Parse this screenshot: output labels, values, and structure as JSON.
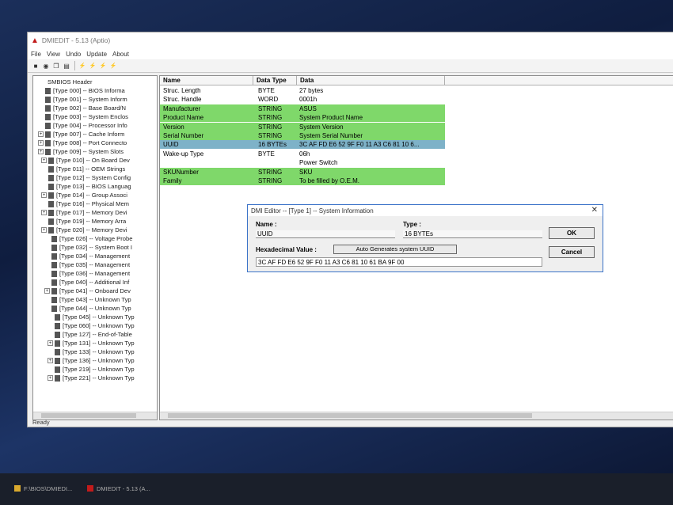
{
  "window": {
    "title": "DMIEDIT - 5.13 (Aptio)"
  },
  "menu": [
    "File",
    "View",
    "Undo",
    "Update",
    "About"
  ],
  "toolbar": {
    "buttons": [
      "save-icon",
      "open-icon",
      "copy-icon",
      "doc-icon",
      "all-icon-1",
      "all-icon-2",
      "all-icon-3",
      "all-icon-4"
    ]
  },
  "tree": {
    "items": [
      {
        "label": "SMBIOS Header",
        "exp": ""
      },
      {
        "label": "[Type 000] -- BIOS Informa",
        "exp": ""
      },
      {
        "label": "[Type 001] -- System Inform",
        "exp": ""
      },
      {
        "label": "[Type 002] -- Base Board/N",
        "exp": ""
      },
      {
        "label": "[Type 003] -- System Enclos",
        "exp": ""
      },
      {
        "label": "[Type 004] -- Processor Info",
        "exp": ""
      },
      {
        "label": "[Type 007] -- Cache Inform",
        "exp": "+"
      },
      {
        "label": "[Type 008] -- Port Connecto",
        "exp": "+"
      },
      {
        "label": "[Type 009] -- System Slots",
        "exp": "+"
      },
      {
        "label": "[Type 010] -- On Board Dev",
        "exp": "+"
      },
      {
        "label": "[Type 011] -- OEM Strings",
        "exp": ""
      },
      {
        "label": "[Type 012] -- System Config",
        "exp": ""
      },
      {
        "label": "[Type 013] -- BIOS Languag",
        "exp": ""
      },
      {
        "label": "[Type 014] -- Group Associ",
        "exp": "+"
      },
      {
        "label": "[Type 016] -- Physical Mem",
        "exp": ""
      },
      {
        "label": "[Type 017] -- Memory Devi",
        "exp": "+"
      },
      {
        "label": "[Type 019] -- Memory Arra",
        "exp": ""
      },
      {
        "label": "[Type 020] -- Memory Devi",
        "exp": "+"
      },
      {
        "label": "[Type 026] -- Voltage Probe",
        "exp": ""
      },
      {
        "label": "[Type 032] -- System Boot I",
        "exp": ""
      },
      {
        "label": "[Type 034] -- Management",
        "exp": ""
      },
      {
        "label": "[Type 035] -- Management",
        "exp": ""
      },
      {
        "label": "[Type 036] -- Management",
        "exp": ""
      },
      {
        "label": "[Type 040] -- Additional Inf",
        "exp": ""
      },
      {
        "label": "[Type 041] -- Onboard Dev",
        "exp": "+"
      },
      {
        "label": "[Type 043] -- Unknown Typ",
        "exp": ""
      },
      {
        "label": "[Type 044] -- Unknown Typ",
        "exp": ""
      },
      {
        "label": "[Type 045] -- Unknown Typ",
        "exp": ""
      },
      {
        "label": "[Type 060] -- Unknown Typ",
        "exp": ""
      },
      {
        "label": "[Type 127] -- End-of-Table",
        "exp": ""
      },
      {
        "label": "[Type 131] -- Unknown Typ",
        "exp": "+"
      },
      {
        "label": "[Type 133] -- Unknown Typ",
        "exp": ""
      },
      {
        "label": "[Type 136] -- Unknown Typ",
        "exp": "+"
      },
      {
        "label": "[Type 219] -- Unknown Typ",
        "exp": ""
      },
      {
        "label": "[Type 221] -- Unknown Typ",
        "exp": "+"
      }
    ]
  },
  "table": {
    "headers": [
      "Name",
      "Data Type",
      "Data"
    ],
    "rows": [
      {
        "name": "Struc. Length",
        "type": "BYTE",
        "data": "27 bytes",
        "style": ""
      },
      {
        "name": "Struc. Handle",
        "type": "WORD",
        "data": "0001h",
        "style": ""
      },
      {
        "name": "Manufacturer",
        "type": "STRING",
        "data": "ASUS",
        "style": "green"
      },
      {
        "name": "Product Name",
        "type": "STRING",
        "data": "System Product Name",
        "style": "green"
      },
      {
        "name": "Version",
        "type": "STRING",
        "data": "System Version",
        "style": "green"
      },
      {
        "name": "Serial Number",
        "type": "STRING",
        "data": "System Serial Number",
        "style": "green"
      },
      {
        "name": "UUID",
        "type": "16 BYTEs",
        "data": "3C AF FD E6 52 9F F0 11 A3 C6 81 10 6...",
        "style": "sel"
      },
      {
        "name": "Wake-up Type",
        "type": "BYTE",
        "data": "06h",
        "style": ""
      },
      {
        "name": "",
        "type": "",
        "data": "Power Switch",
        "style": ""
      },
      {
        "name": "SKUNumber",
        "type": "STRING",
        "data": "SKU",
        "style": "green"
      },
      {
        "name": "Family",
        "type": "STRING",
        "data": "To be filled by O.E.M.",
        "style": "green"
      }
    ]
  },
  "status": "Ready",
  "dialog": {
    "title": "DMI Editor -- [Type   1] -- System Information",
    "name_label": "Name :",
    "name_value": "UUID",
    "type_label": "Type :",
    "type_value": "16 BYTEs",
    "hex_label": "Hexadecimal Value :",
    "auto_button": "Auto Generates system UUID",
    "hex_value": "3C AF FD E6 52 9F F0 11 A3 C6 81 10 61 BA 9F 00",
    "ok": "OK",
    "cancel": "Cancel",
    "close": "✕"
  },
  "taskbar": {
    "items": [
      "F:\\BIOS\\DMIEDI...",
      "DMIEDIT - 5.13 (A..."
    ]
  },
  "colors": {
    "green_row": "#7fd86a",
    "selected_row": "#7eb2c8",
    "dialog_border": "#3b73c8"
  }
}
